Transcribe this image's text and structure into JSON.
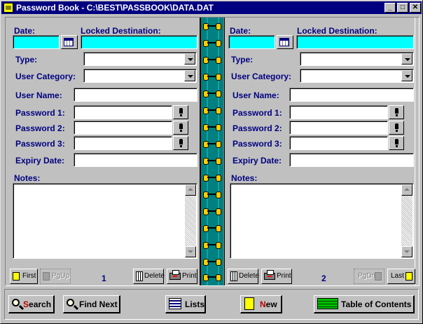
{
  "window": {
    "title": "Password Book - C:\\BEST\\PASSBOOK\\DATA.DAT",
    "minimize": "_",
    "maximize": "□",
    "close": "✕"
  },
  "labels": {
    "date": "Date:",
    "locked_destination": "Locked Destination:",
    "type": "Type:",
    "user_category": "User Category:",
    "user_name": "User Name:",
    "password1": "Password 1:",
    "password2": "Password 2:",
    "password3": "Password 3:",
    "expiry_date": "Expiry Date:",
    "notes": "Notes:"
  },
  "left_page": {
    "page_number": "1",
    "first_label": "First",
    "prev_label": "PgUp",
    "delete_label": "Delete",
    "print_label": "Print"
  },
  "right_page": {
    "page_number": "2",
    "next_label": "PgDn",
    "last_label": "Last",
    "delete_label": "Delete",
    "print_label": "Print"
  },
  "bottombar": {
    "search_label": "Search",
    "search_hot": "S",
    "find_next_label": "Find Next",
    "lists_label": "Lists",
    "new_label": "New",
    "new_hot": "N",
    "toc_label": "Table of Contents"
  },
  "colors": {
    "title_bar": "#000080",
    "highlight_field": "#00ffff",
    "spine": "#008080",
    "label_text": "#000080"
  }
}
